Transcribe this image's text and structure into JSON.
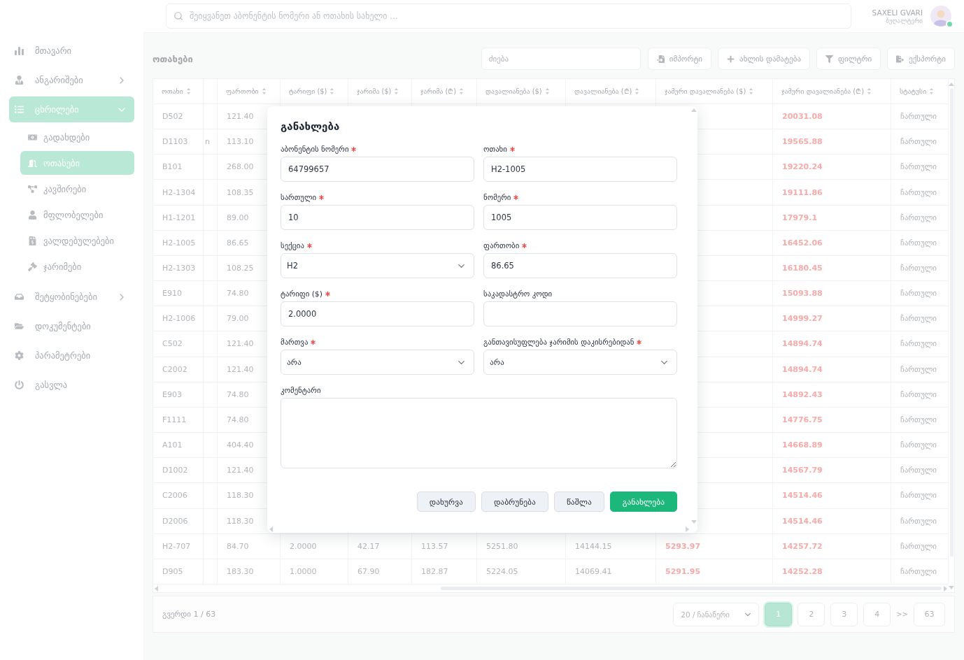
{
  "topbar": {
    "search": {
      "placeholder": "შეიყვანეთ აბონენტის ნომერი ან ოთახის სახელი ..."
    },
    "user": {
      "name": "SAXELI GVARI",
      "role": "ბუღალტერი",
      "online": true
    }
  },
  "sidebar": {
    "items": [
      {
        "label": "მთავარი",
        "kind": "link",
        "selected": false
      },
      {
        "label": "ანგარიშები",
        "kind": "group",
        "selected": false,
        "expanded": false
      },
      {
        "label": "ცხრილები",
        "kind": "group",
        "selected": true,
        "expanded": true,
        "children": [
          {
            "label": "გადახდები",
            "selected": false
          },
          {
            "label": "ოთახები",
            "selected": true
          },
          {
            "label": "კავშირები",
            "selected": false
          },
          {
            "label": "მფლობელები",
            "selected": false
          },
          {
            "label": "ვალდებულებები",
            "selected": false
          },
          {
            "label": "ჯარიმები",
            "selected": false
          }
        ]
      },
      {
        "label": "შეტყობინებები",
        "kind": "group",
        "selected": false,
        "expanded": false
      },
      {
        "label": "დოკუმენტები",
        "kind": "link",
        "selected": false
      },
      {
        "label": "პარამეტრები",
        "kind": "link",
        "selected": false
      },
      {
        "label": "გასვლა",
        "kind": "link",
        "selected": false
      }
    ]
  },
  "page": {
    "title": "ოთახები",
    "search": {
      "placeholder": "ძიება"
    },
    "buttons": [
      {
        "label": "იმპორტი"
      },
      {
        "label": "ახლის დამატება"
      },
      {
        "label": "ფილტრი"
      },
      {
        "label": "ექსპორტი"
      }
    ]
  },
  "table": {
    "columns": [
      {
        "label": "ოთახი",
        "sortable": true
      },
      {
        "sortable": false
      },
      {
        "label": "ფართობი",
        "sortable": true
      },
      {
        "label": "ტარიფი ($)",
        "sortable": true
      },
      {
        "label": "ჯარიმა ($)",
        "sortable": true
      },
      {
        "label": "ჯარიმა (₾)",
        "sortable": true
      },
      {
        "label": "დავალიანება ($)",
        "sortable": true
      },
      {
        "label": "დავალიანება (₾)",
        "sortable": true
      },
      {
        "label": "ჯამური დავალიანება ($)",
        "sortable": true
      },
      {
        "label": "ჯამური დავალიანება (₾)",
        "sortable": true
      },
      {
        "label": "სტატუსი",
        "sortable": true
      }
    ],
    "rows": [
      {
        "room": "D502",
        "area": "121.40",
        "total_debt_gel": "20031.08",
        "status": "ჩართული"
      },
      {
        "room": "D1103",
        "column_2": "n",
        "area": "113.10",
        "total_debt_gel": "19565.88",
        "status": "ჩართული"
      },
      {
        "room": "B101",
        "area": "268.00",
        "total_debt_gel": "19220.24",
        "status": "ჩართული"
      },
      {
        "room": "H2-1304",
        "area": "108.35",
        "total_debt_gel": "19111.86",
        "status": "ჩართული"
      },
      {
        "room": "H1-1201",
        "area": "89.00",
        "total_debt_gel": "17979.1",
        "status": "ჩართული"
      },
      {
        "room": "H2-1005",
        "area": "86.65",
        "total_debt_gel": "16452.06",
        "status": "ჩართული"
      },
      {
        "room": "H2-1303",
        "area": "108.25",
        "total_debt_gel": "16180.45",
        "status": "ჩართული"
      },
      {
        "room": "E910",
        "area": "74.80",
        "total_debt_gel": "15093.88",
        "status": "ჩართული"
      },
      {
        "room": "H2-1006",
        "area": "79.00",
        "total_debt_gel": "14999.27",
        "status": "ჩართული"
      },
      {
        "room": "C502",
        "area": "121.40",
        "total_debt_gel": "14894.74",
        "status": "ჩართული"
      },
      {
        "room": "C2002",
        "area": "121.40",
        "total_debt_gel": "14894.74",
        "status": "ჩართული"
      },
      {
        "room": "E903",
        "area": "74.80",
        "total_debt_gel": "14892.43",
        "status": "ჩართული"
      },
      {
        "room": "F1111",
        "area": "74.80",
        "total_debt_gel": "14776.75",
        "status": "ჩართული"
      },
      {
        "room": "A101",
        "area": "404.40",
        "total_debt_gel": "14668.89",
        "status": "ჩართული"
      },
      {
        "room": "D1002",
        "area": "121.40",
        "total_debt_gel": "14567.79",
        "status": "ჩართული"
      },
      {
        "room": "C2006",
        "area": "118.30",
        "total_debt_gel": "14514.46",
        "status": "ჩართული"
      },
      {
        "room": "D2006",
        "area": "118.30",
        "total_debt_gel": "14514.46",
        "status": "ჩართული"
      },
      {
        "room": "H2-707",
        "area": "84.70",
        "tariff_usd": "2.0000",
        "fine_usd": "42.17",
        "fine_gel": "113.57",
        "debt_usd": "5251.80",
        "debt_gel": "14144.15",
        "total_debt_usd": "5293.97",
        "total_debt_gel": "14257.72",
        "status": "ჩართული"
      },
      {
        "room": "D905",
        "area": "183.30",
        "tariff_usd": "1.0000",
        "fine_usd": "67.90",
        "fine_gel": "182.87",
        "debt_usd": "5224.05",
        "debt_gel": "14069.41",
        "total_debt_usd": "5291.95",
        "total_debt_gel": "14252.28",
        "status": "ჩართული"
      }
    ]
  },
  "pagination": {
    "summary": "გვერდი 1 / 63",
    "page_size": "20 / ჩანაწერი",
    "pages": [
      {
        "label": "1",
        "selected": true
      },
      {
        "label": "2",
        "selected": false
      },
      {
        "label": "3",
        "selected": false
      },
      {
        "label": "4",
        "selected": false
      }
    ],
    "more": ">>",
    "last_page": {
      "label": "63",
      "selected": false
    }
  },
  "modal": {
    "title": "განახლება",
    "fields": [
      {
        "label": "აბონენტის ნომერი",
        "required": true,
        "kind": "text",
        "value": "64799657"
      },
      {
        "label": "ოთახი",
        "required": true,
        "kind": "text",
        "value": "H2-1005"
      },
      {
        "label": "სართული",
        "required": true,
        "kind": "text",
        "value": "10"
      },
      {
        "label": "ნომერი",
        "required": true,
        "kind": "text",
        "value": "1005"
      },
      {
        "label": "სექცია",
        "required": true,
        "kind": "select",
        "value": "H2"
      },
      {
        "label": "ფართობი",
        "required": true,
        "kind": "text",
        "value": "86.65"
      },
      {
        "label": "ტარიფი ($)",
        "required": true,
        "kind": "text",
        "value": "2.0000"
      },
      {
        "label": "საკადასტრო კოდი",
        "required": false,
        "kind": "text"
      },
      {
        "label": "მართვა",
        "required": true,
        "kind": "select",
        "value": "არა"
      },
      {
        "label": "განთავისუფლება ჯარიმის დაკისრებიდან",
        "required": true,
        "kind": "select",
        "value": "არა"
      },
      {
        "label": "კომენტარი",
        "required": false,
        "kind": "textarea"
      }
    ],
    "buttons": [
      {
        "label": "დახურვა",
        "kind": "secondary"
      },
      {
        "label": "დაბრუნება",
        "kind": "secondary"
      },
      {
        "label": "წაშლა",
        "kind": "secondary"
      },
      {
        "label": "განახლება",
        "kind": "primary"
      }
    ]
  }
}
